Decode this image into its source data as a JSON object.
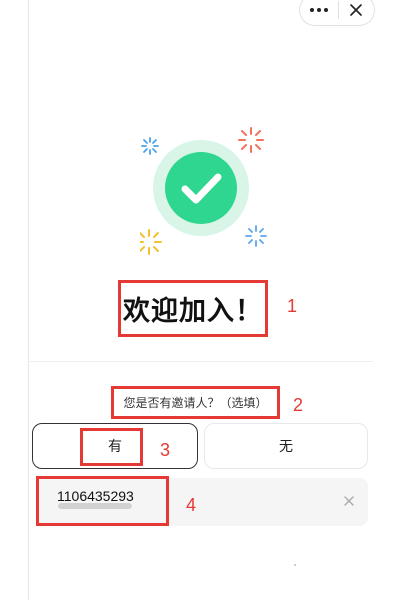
{
  "window_controls": {
    "more_icon": "more-dots-icon",
    "close_icon": "close-icon"
  },
  "hero": {
    "icon": "success-check-icon",
    "accent_green": "#2ed68f",
    "sparkle_colors": [
      "#4aa3e6",
      "#f2735b",
      "#f2c230",
      "#5aa6e8"
    ]
  },
  "welcome": {
    "title": "欢迎加入！"
  },
  "invite": {
    "question": "您是否有邀请人？（选填）",
    "option_yes": "有",
    "option_no": "无",
    "selected": "有",
    "code_value": "1106435293",
    "clear_icon": "clear-icon"
  },
  "annotations": {
    "a1": "1",
    "a2": "2",
    "a3": "3",
    "a4": "4",
    "color": "#e53935"
  }
}
